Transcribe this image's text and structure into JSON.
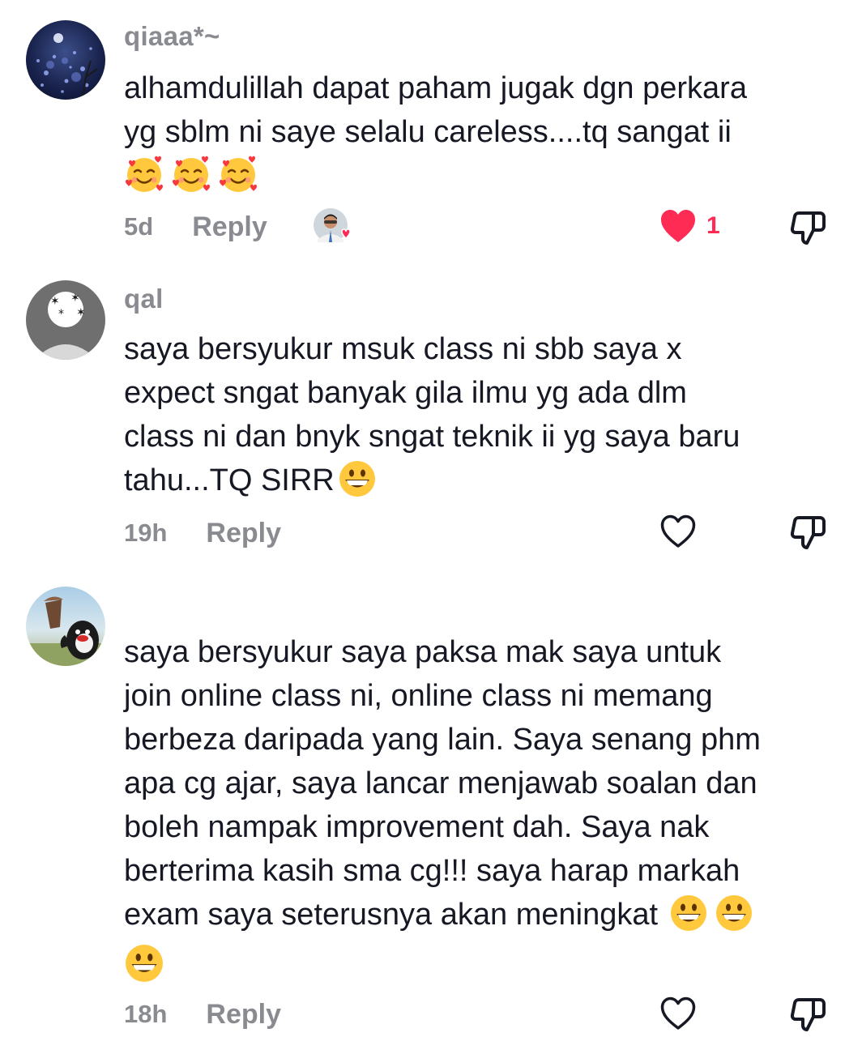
{
  "comments": [
    {
      "username": "qiaaa*~",
      "text": "alhamdulillah dapat paham jugak dgn perkara\nyg sblm ni saye selalu careless....tq sangat ii",
      "emojis": [
        "smiling-face-with-hearts",
        "smiling-face-with-hearts",
        "smiling-face-with-hearts"
      ],
      "time": "5d",
      "reply_label": "Reply",
      "liked": true,
      "like_count": "1",
      "liked_by_creator": true
    },
    {
      "username": "qal",
      "text": "saya bersyukur msuk class ni sbb saya x\nexpect sngat banyak gila ilmu yg ada dlm\nclass ni dan bnyk sngat teknik ii yg saya baru\ntahu...TQ SIRR",
      "trailing_emoji": "grinning-face",
      "time": "19h",
      "reply_label": "Reply",
      "liked": false,
      "like_count": ""
    },
    {
      "username": "",
      "text": "saya bersyukur saya paksa mak saya untuk\njoin online class ni, online class ni memang\nberbeza daripada yang lain. Saya senang phm\napa cg ajar, saya lancar menjawab soalan dan\nboleh nampak improvement dah. Saya nak\nberterima kasih sma cg!!! saya harap markah\nexam saya seterusnya akan meningkat",
      "inline_emojis": [
        "grinning-face",
        "grinning-face"
      ],
      "trailing_emoji": "grinning-face",
      "time": "18h",
      "reply_label": "Reply",
      "liked": false,
      "like_count": ""
    }
  ],
  "colors": {
    "text": "#161823",
    "muted": "#8a8b91",
    "like_red": "#fe2c55"
  }
}
